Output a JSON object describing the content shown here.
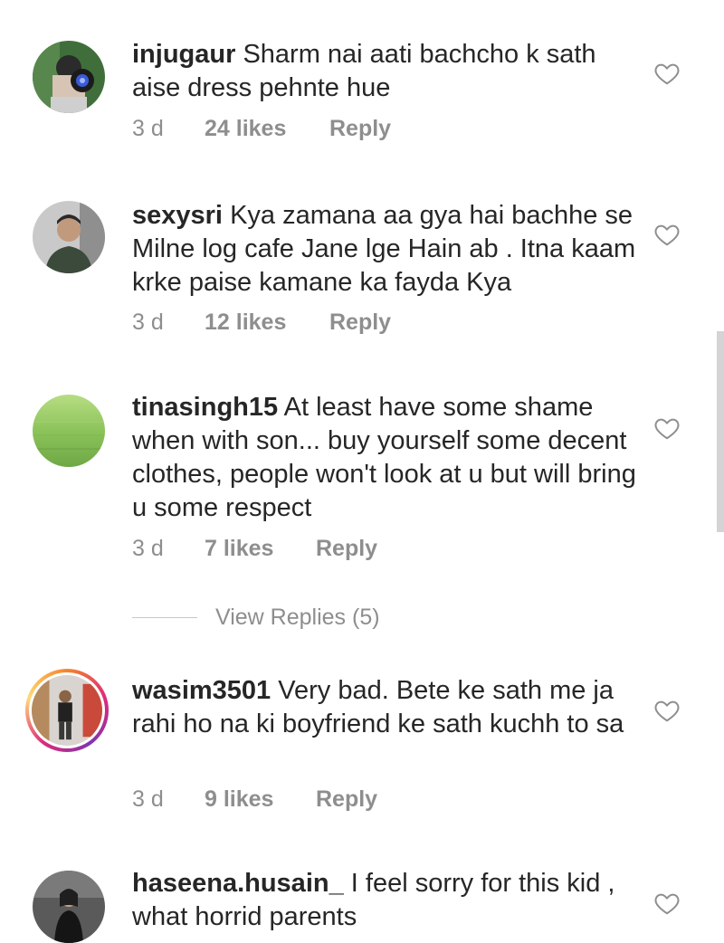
{
  "comments": [
    {
      "username": "injugaur",
      "text": "Sharm nai aati bachcho k sath aise dress pehnte hue",
      "time": "3 d",
      "likes": "24 likes",
      "reply": "Reply"
    },
    {
      "username": "sexysri",
      "text": "Kya zamana aa gya hai bachhe se Milne log cafe Jane lge Hain ab . Itna kaam krke paise kamane ka fayda Kya",
      "time": "3 d",
      "likes": "12 likes",
      "reply": "Reply"
    },
    {
      "username": "tinasingh15",
      "text": "At least have some shame when with son... buy yourself some decent clothes, people won't look at u but will bring u some respect",
      "time": "3 d",
      "likes": "7 likes",
      "reply": "Reply"
    },
    {
      "username": "wasim3501",
      "text": "Very bad. Bete ke sath me ja rahi ho na ki boyfriend ke sath kuchh to sa",
      "time": "3 d",
      "likes": "9 likes",
      "reply": "Reply"
    },
    {
      "username": "haseena.husain_",
      "text": "I feel sorry for this kid , what horrid parents",
      "time": "",
      "likes": "",
      "reply": ""
    }
  ],
  "view_replies": "View Replies (5)",
  "colors": {
    "text": "#262626",
    "meta": "#8e8e8e",
    "story_ring": "#dd2a7b"
  },
  "icons": {
    "like": "heart-outline-icon"
  }
}
